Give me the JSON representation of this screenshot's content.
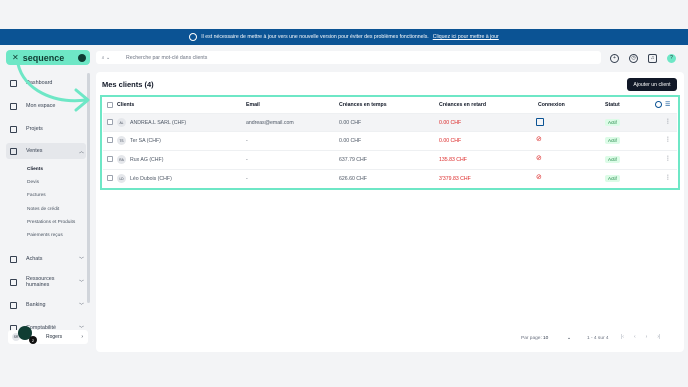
{
  "banner": {
    "message": "Il est nécessaire de mettre à jour vers une nouvelle version pour éviter des problèmes fonctionnels.",
    "link": "Cliquez ici pour mettre à jour"
  },
  "sidebar": {
    "brand": "sequence",
    "items": [
      {
        "label": "Dashboard"
      },
      {
        "label": "Mon espace"
      },
      {
        "label": "Projets"
      },
      {
        "label": "Ventes"
      },
      {
        "label": "Achats"
      },
      {
        "label": "Ressources humaines"
      },
      {
        "label": "Banking"
      },
      {
        "label": "Comptabilité"
      }
    ],
    "sub_items": [
      "Clients",
      "Devis",
      "Factures",
      "Notes de crédit",
      "Prestations et Produits",
      "Paiements reçus"
    ],
    "user": {
      "initials": "SR",
      "name": "Rogers"
    },
    "float_badge": "2"
  },
  "search": {
    "placeholder": "Recherche par mot-clé dans clients"
  },
  "header": {
    "avatar_initial": "?"
  },
  "page": {
    "title": "Mes clients (4)",
    "add_button": "Ajouter un client"
  },
  "table": {
    "headers": [
      "Clients",
      "Email",
      "Créances en temps",
      "Créances en retard",
      "Connexion",
      "Statut"
    ],
    "rows": [
      {
        "initials": "AL",
        "name": "ANDREA.L SARL (CHF)",
        "email": "andreas@email.com",
        "on_time": "0.00 CHF",
        "late": "0.00 CHF",
        "status": "Actif"
      },
      {
        "initials": "TS",
        "name": "Ter SA (CHF)",
        "email": "-",
        "on_time": "0.00 CHF",
        "late": "0.00 CHF",
        "status": "Actif"
      },
      {
        "initials": "RA",
        "name": "Rux AG (CHF)",
        "email": "-",
        "on_time": "637.79 CHF",
        "late": "135.83 CHF",
        "status": "Actif"
      },
      {
        "initials": "LD",
        "name": "Léo Dubois (CHF)",
        "email": "-",
        "on_time": "626.60 CHF",
        "late": "3'379.83 CHF",
        "status": "Actif"
      }
    ]
  },
  "footer": {
    "per_page_label": "Par page:",
    "per_page_value": "10",
    "range": "1 - 4 sur 4"
  }
}
